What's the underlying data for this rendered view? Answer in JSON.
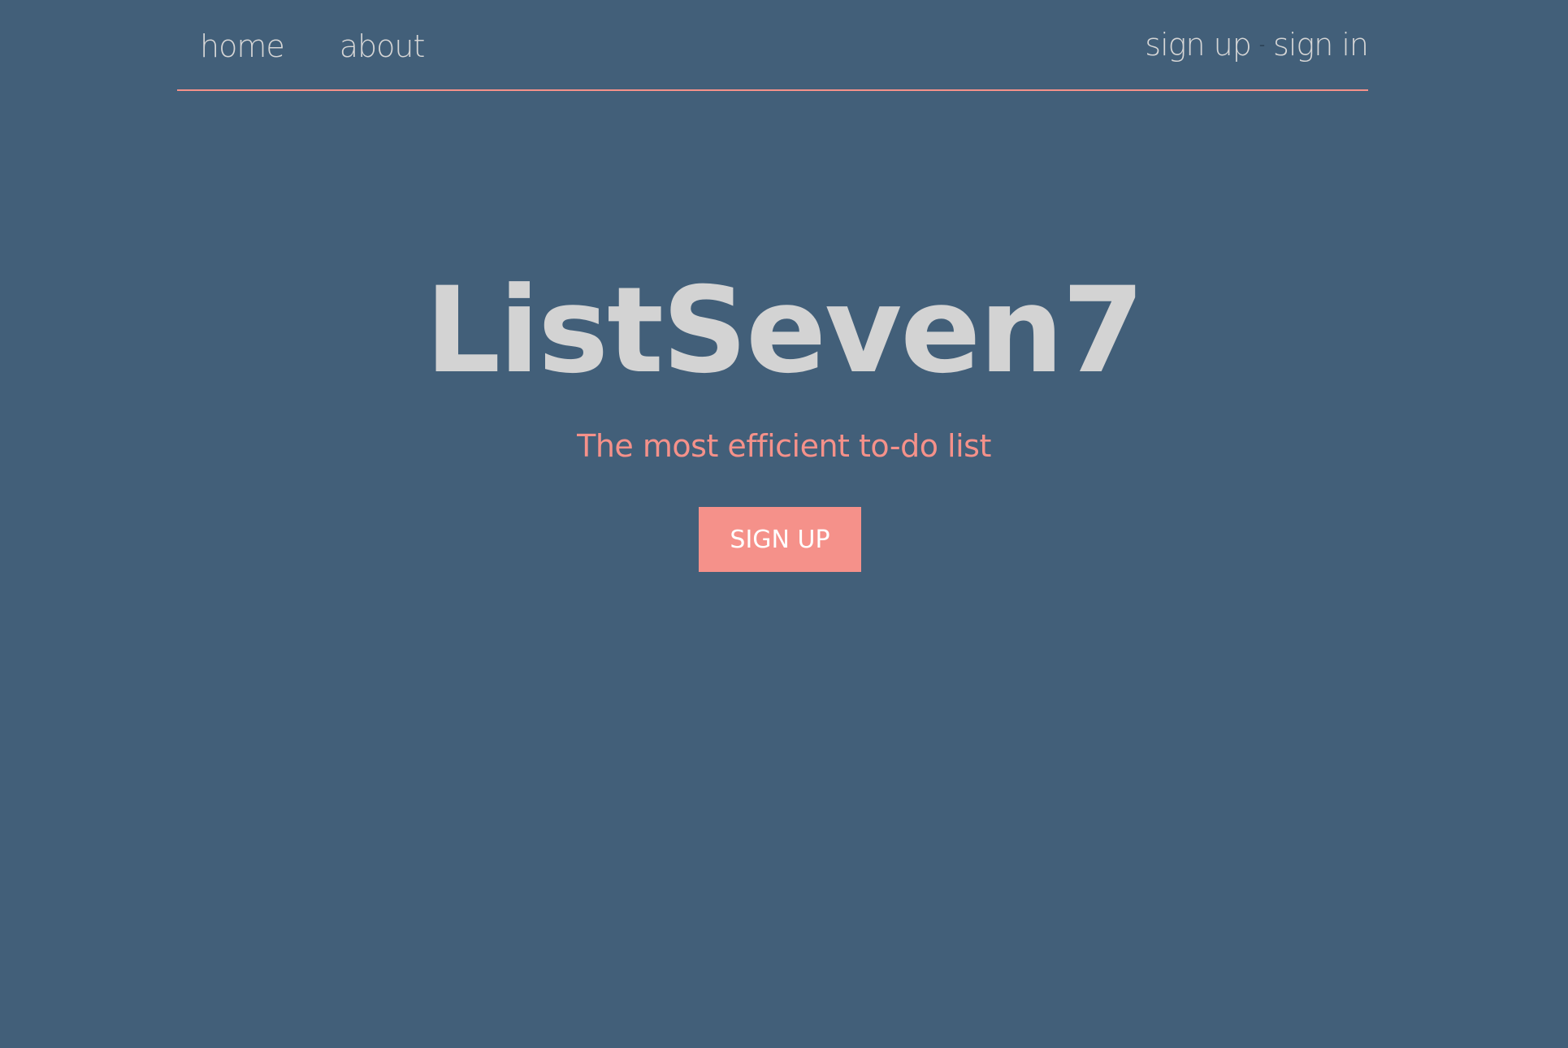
{
  "nav": {
    "left_links": [
      "home",
      "about"
    ],
    "sign_up": "sign up",
    "separator": "-",
    "sign_in": "sign in"
  },
  "hero": {
    "brand": "ListSeven7",
    "tagline": "The most efficient to-do list",
    "cta_label": "SIGN UP"
  },
  "colors": {
    "background": "#425f79",
    "accent": "#f5918a",
    "text": "#d6d6d6"
  }
}
